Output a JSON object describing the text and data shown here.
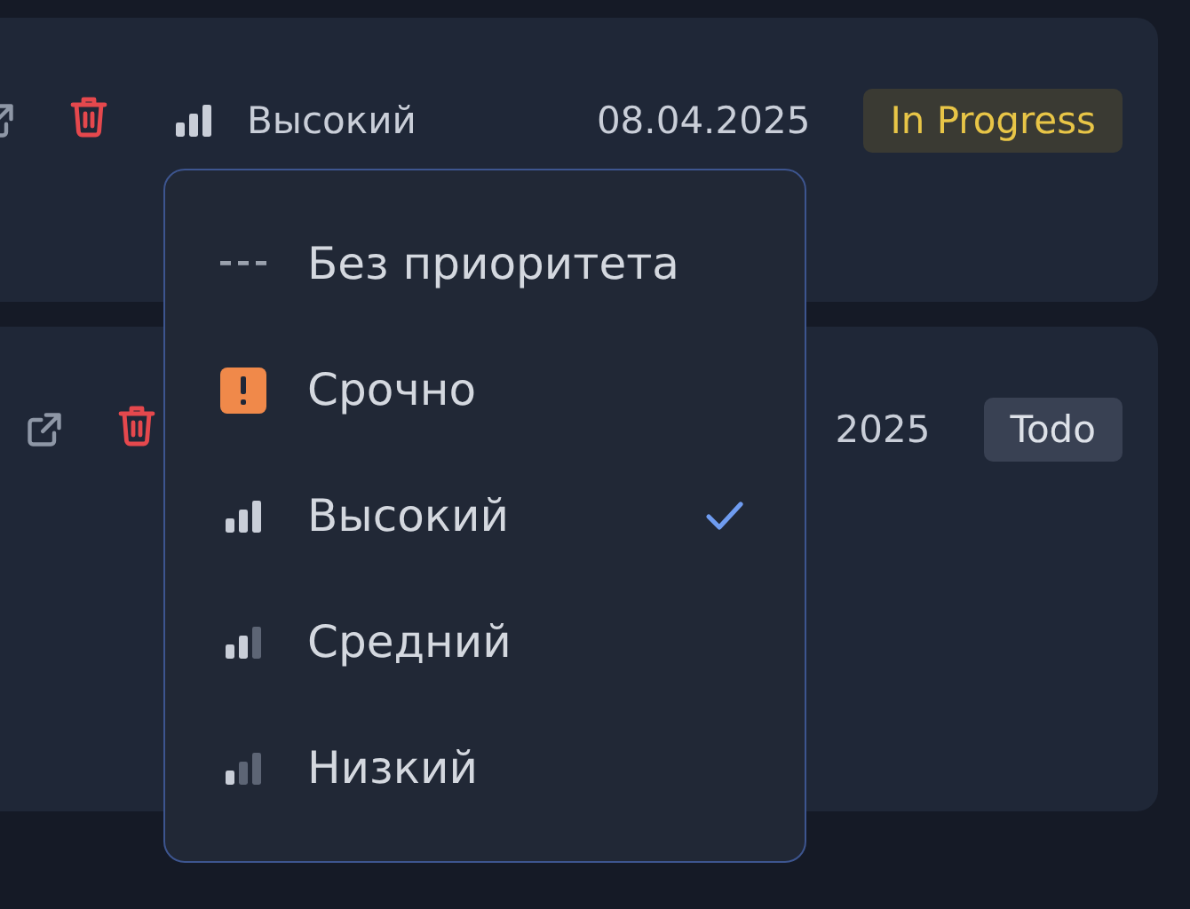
{
  "tasks": [
    {
      "priority": {
        "kind": "high",
        "label": "Высокий"
      },
      "date": "08.04.2025",
      "status": {
        "kind": "in_progress",
        "label": "In Progress"
      }
    },
    {
      "date": "2025",
      "status": {
        "kind": "todo",
        "label": "Todo"
      }
    }
  ],
  "priority_menu": {
    "items": [
      {
        "kind": "none",
        "label": "Без приоритета",
        "selected": false
      },
      {
        "kind": "urgent",
        "label": "Срочно",
        "selected": false
      },
      {
        "kind": "high",
        "label": "Высокий",
        "selected": true
      },
      {
        "kind": "medium",
        "label": "Средний",
        "selected": false
      },
      {
        "kind": "low",
        "label": "Низкий",
        "selected": false
      }
    ]
  }
}
